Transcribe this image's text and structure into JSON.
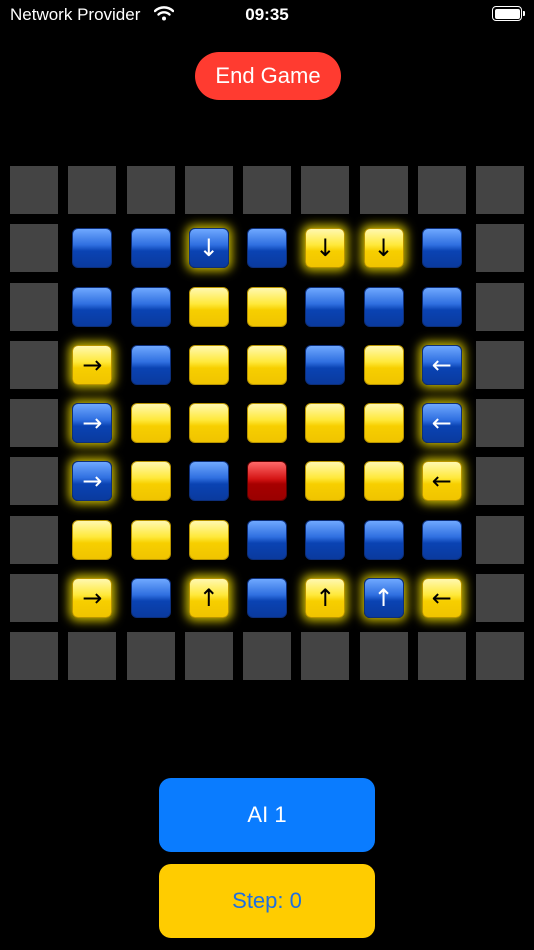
{
  "status_bar": {
    "carrier": "Network Provider",
    "time": "09:35",
    "battery_level": 1.0
  },
  "end_game": {
    "label": "End Game",
    "color": "#ff3b30"
  },
  "board": {
    "size": 9,
    "grid": [
      [
        "wall",
        "wall",
        "wall",
        "wall",
        "wall",
        "wall",
        "wall",
        "wall",
        "wall"
      ],
      [
        "wall",
        "B",
        "B",
        "B:down",
        "B",
        "Y:down",
        "Y:down",
        "B",
        "wall"
      ],
      [
        "wall",
        "B",
        "B",
        "Y",
        "Y",
        "B",
        "B",
        "B",
        "wall"
      ],
      [
        "wall",
        "Y:right",
        "B",
        "Y",
        "Y",
        "B",
        "Y",
        "B:left",
        "wall"
      ],
      [
        "wall",
        "B:right",
        "Y",
        "Y",
        "Y",
        "Y",
        "Y",
        "B:left",
        "wall"
      ],
      [
        "wall",
        "B:right",
        "Y",
        "B",
        "R",
        "Y",
        "Y",
        "Y:left",
        "wall"
      ],
      [
        "wall",
        "Y",
        "Y",
        "Y",
        "B",
        "B",
        "B",
        "B",
        "wall"
      ],
      [
        "wall",
        "Y:right",
        "B",
        "Y:up",
        "B",
        "Y:up",
        "B:up",
        "Y:left",
        "wall"
      ],
      [
        "wall",
        "wall",
        "wall",
        "wall",
        "wall",
        "wall",
        "wall",
        "wall",
        "wall"
      ]
    ],
    "colors": {
      "blue": "#1f5fd6",
      "yellow": "#ffe000",
      "red": "#c00000",
      "wall": "#444444"
    },
    "arrow_glyphs": {
      "up": "↑",
      "down": "↓",
      "left": "←",
      "right": "→"
    }
  },
  "ai_button": {
    "label": "AI 1",
    "color": "#0a7cff"
  },
  "step_button": {
    "label": "Step: 0",
    "color": "#ffcc00"
  }
}
